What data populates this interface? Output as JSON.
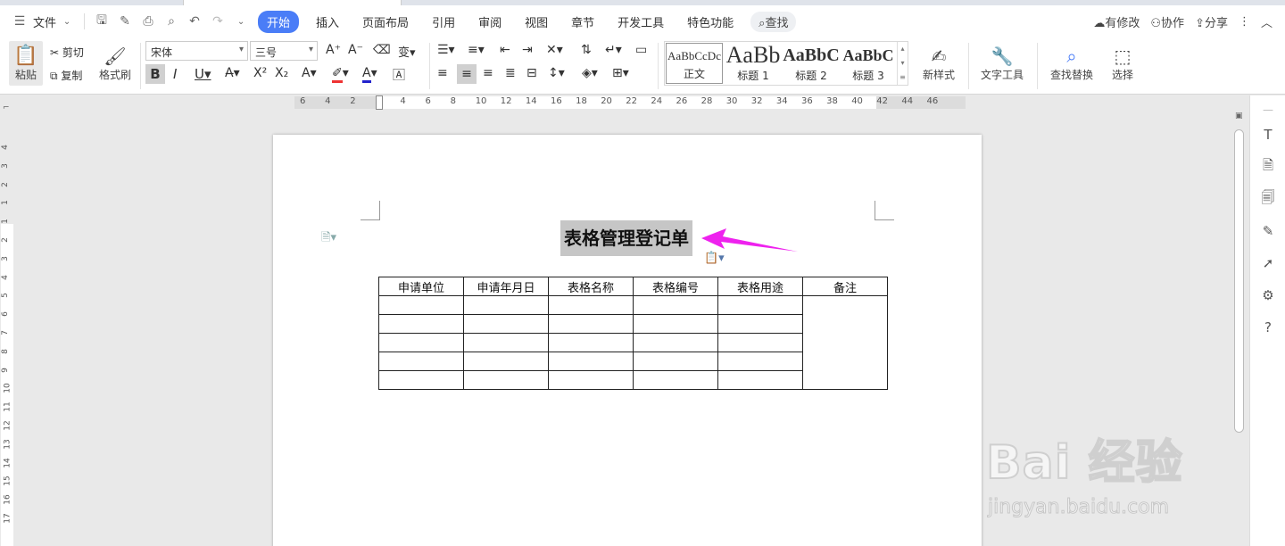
{
  "menu": {
    "file": "文件",
    "tabs": [
      "开始",
      "插入",
      "页面布局",
      "引用",
      "审阅",
      "视图",
      "章节",
      "开发工具",
      "特色功能"
    ],
    "search": "查找",
    "right": {
      "modified": "有修改",
      "collab": "协作",
      "share": "分享"
    }
  },
  "toolbar": {
    "paste": "粘贴",
    "cut": "剪切",
    "copy": "复制",
    "format_painter": "格式刷",
    "font_name": "宋体",
    "font_size": "三号",
    "new_style": "新样式",
    "text_tool": "文字工具",
    "find_replace": "查找替换",
    "select": "选择",
    "styles": [
      {
        "preview": "AaBbCcDc",
        "label": "正文"
      },
      {
        "preview": "AaBb",
        "label": "标题 1"
      },
      {
        "preview": "AaBbC",
        "label": "标题 2"
      },
      {
        "preview": "AaBbC",
        "label": "标题 3"
      }
    ]
  },
  "ruler": {
    "h_numbers": [
      "6",
      "4",
      "2",
      "2",
      "4",
      "6",
      "8",
      "10",
      "12",
      "14",
      "16",
      "18",
      "20",
      "22",
      "24",
      "26",
      "28",
      "30",
      "32",
      "34",
      "36",
      "38",
      "40",
      "42",
      "44",
      "46"
    ],
    "v_numbers": [
      "4",
      "3",
      "2",
      "1",
      "1",
      "2",
      "3",
      "4",
      "5",
      "6",
      "7",
      "8",
      "9",
      "10",
      "11",
      "12",
      "13",
      "14",
      "15",
      "16",
      "17"
    ]
  },
  "document": {
    "title": "表格管理登记单",
    "headers": [
      "申请单位",
      "申请年月日",
      "表格名称",
      "表格编号",
      "表格用途",
      "备注"
    ],
    "empty_rows": 5
  },
  "watermark": {
    "big": "Bai 经验",
    "small": "jingyan.baidu.com"
  },
  "colors": {
    "accent": "#4a7df7",
    "arrow": "#ee22ee",
    "selection": "#c6c6c6"
  }
}
